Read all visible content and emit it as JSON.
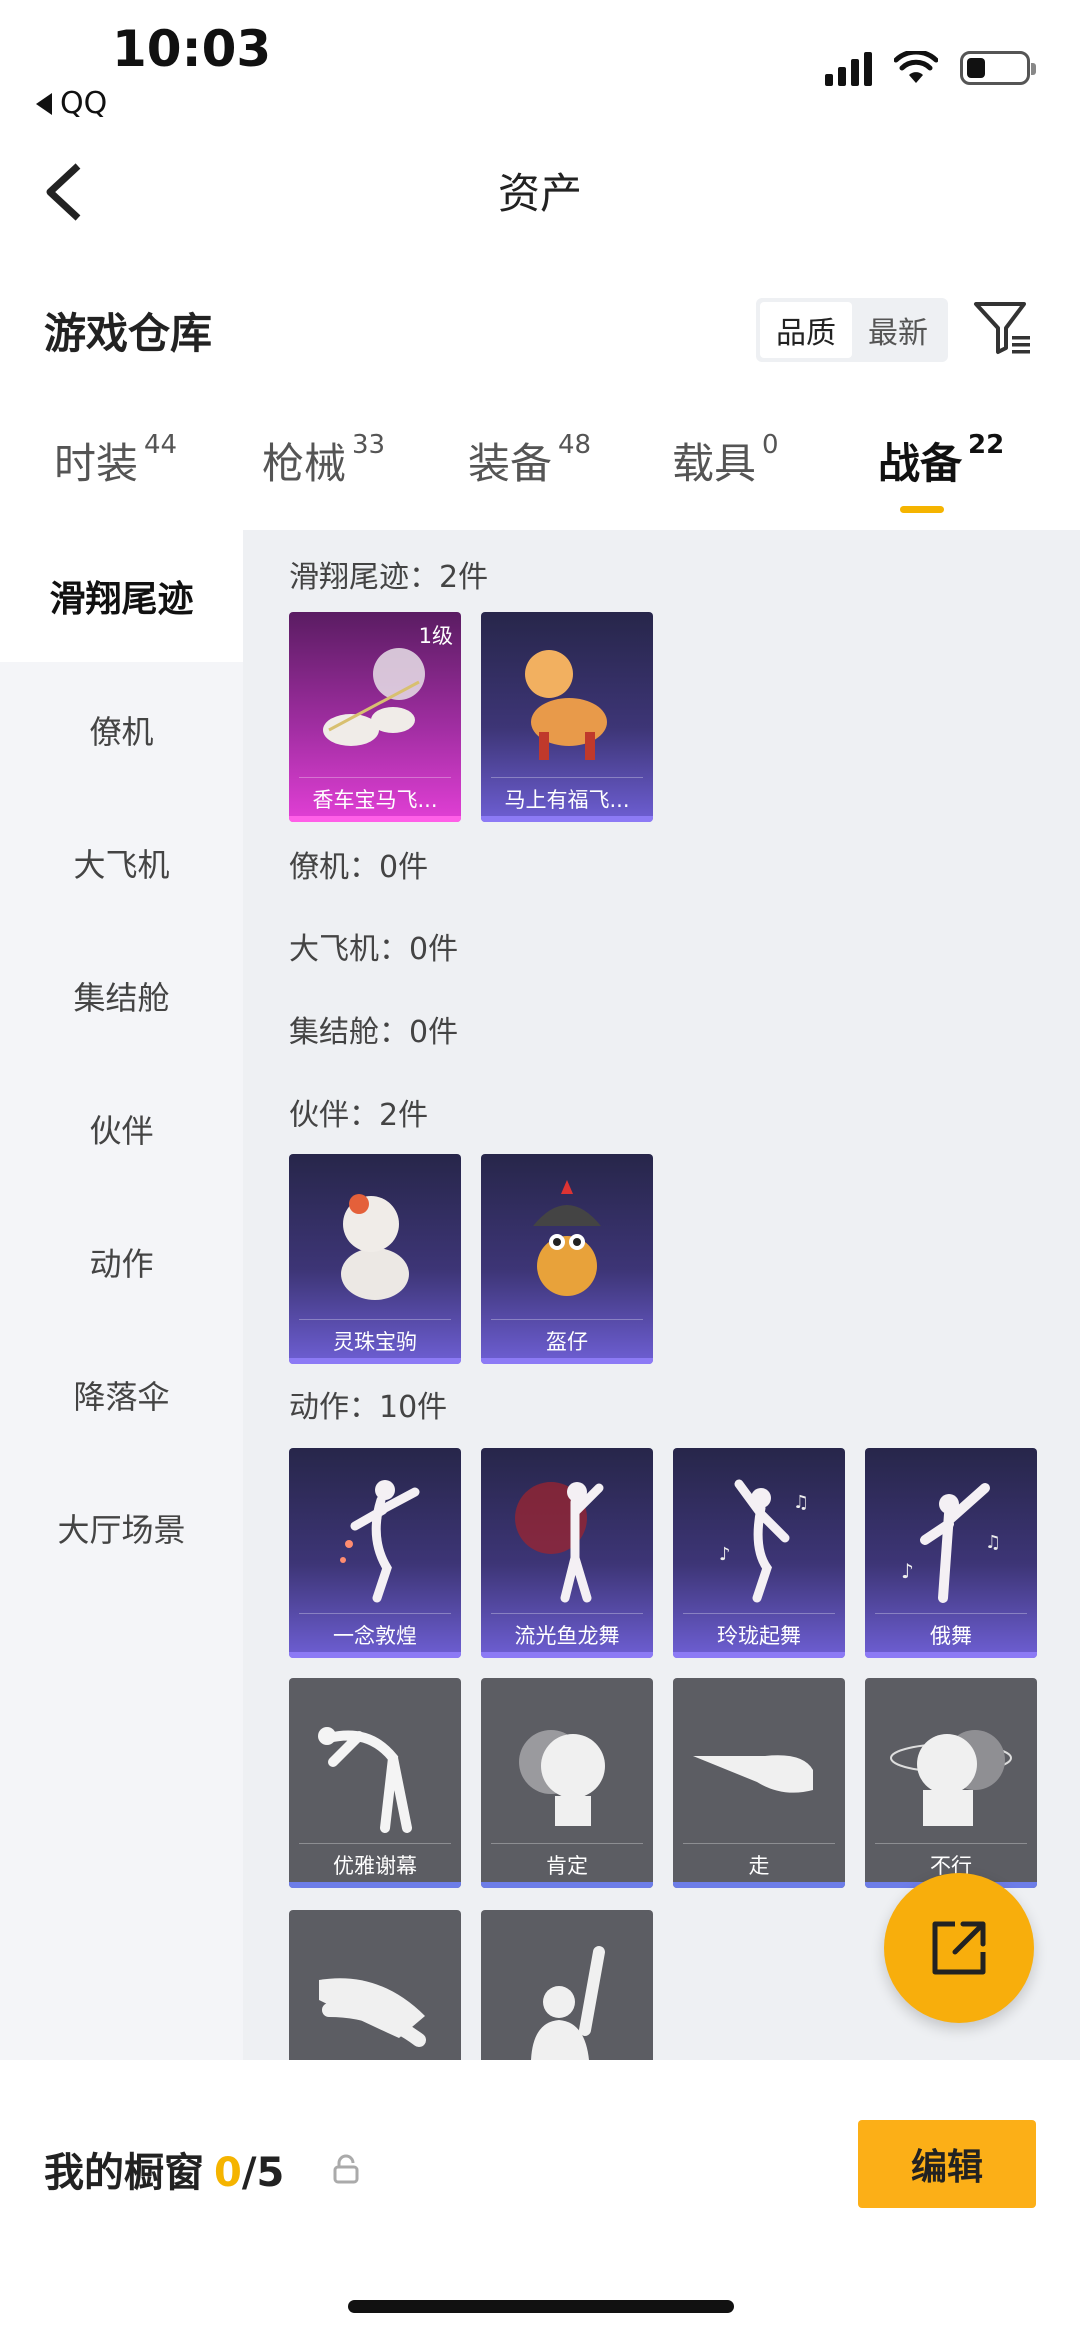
{
  "status_bar": {
    "time": "10:03",
    "back_app": "QQ"
  },
  "header": {
    "title": "资产"
  },
  "section": {
    "title": "游戏仓库"
  },
  "sort": {
    "quality": "品质",
    "latest": "最新",
    "active": "quality"
  },
  "tabs": [
    {
      "label": "时装",
      "count": "44"
    },
    {
      "label": "枪械",
      "count": "33"
    },
    {
      "label": "装备",
      "count": "48"
    },
    {
      "label": "载具",
      "count": "0"
    },
    {
      "label": "战备",
      "count": "22",
      "active": true
    }
  ],
  "sidebar": {
    "items": [
      {
        "label": "滑翔尾迹",
        "active": true
      },
      {
        "label": "僚机"
      },
      {
        "label": "大飞机"
      },
      {
        "label": "集结舱"
      },
      {
        "label": "伙伴"
      },
      {
        "label": "动作"
      },
      {
        "label": "降落伞"
      },
      {
        "label": "大厅场景"
      }
    ]
  },
  "categories": {
    "glide": {
      "label": "滑翔尾迹：2件",
      "items": [
        {
          "name": "香车宝马飞...",
          "level": "1级",
          "rarity": "pink"
        },
        {
          "name": "马上有福飞...",
          "rarity": "purple"
        }
      ]
    },
    "wingman": {
      "label": "僚机：0件"
    },
    "plane": {
      "label": "大飞机：0件"
    },
    "pod": {
      "label": "集结舱：0件"
    },
    "partner": {
      "label": "伙伴：2件",
      "items": [
        {
          "name": "灵珠宝驹",
          "rarity": "purple"
        },
        {
          "name": "盔仔",
          "rarity": "purple"
        }
      ]
    },
    "action": {
      "label": "动作：10件",
      "items": [
        {
          "name": "一念敦煌",
          "rarity": "purple"
        },
        {
          "name": "流光鱼龙舞",
          "rarity": "purple"
        },
        {
          "name": "玲珑起舞",
          "rarity": "purple"
        },
        {
          "name": "俄舞",
          "rarity": "purple"
        },
        {
          "name": "优雅谢幕",
          "rarity": "gray"
        },
        {
          "name": "肯定",
          "rarity": "gray"
        },
        {
          "name": "走",
          "rarity": "gray"
        },
        {
          "name": "不行",
          "rarity": "gray"
        },
        {
          "name": "",
          "rarity": "gray"
        },
        {
          "name": "",
          "rarity": "gray"
        }
      ]
    }
  },
  "showcase": {
    "label": "我的橱窗",
    "current": "0",
    "total": "/5",
    "edit": "编辑"
  },
  "colors": {
    "accent": "#f5b400",
    "button": "#fcaf17",
    "rare_purple": "#6e5fd4",
    "rare_pink": "#e23fd6"
  }
}
